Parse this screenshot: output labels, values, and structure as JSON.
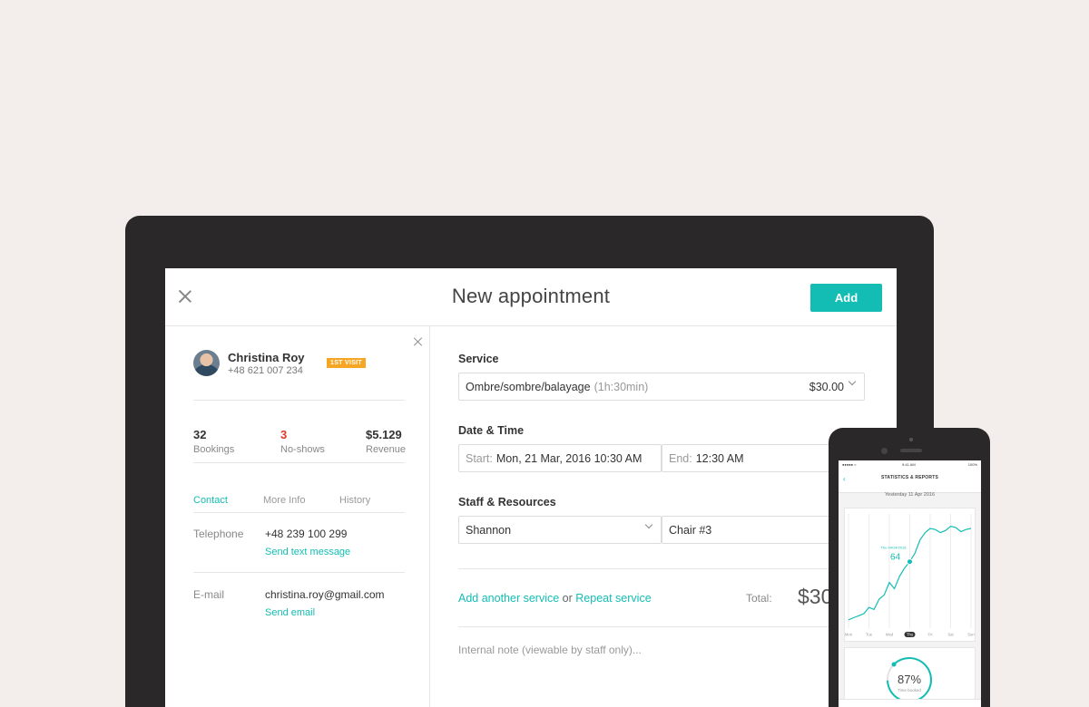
{
  "modal": {
    "title": "New appointment",
    "add_label": "Add"
  },
  "client": {
    "name": "Christina Roy",
    "phone": "+48 621 007 234",
    "badge": "1ST VISIT",
    "stats": [
      {
        "value": "32",
        "label": "Bookings"
      },
      {
        "value": "3",
        "label": "No-shows"
      },
      {
        "value": "$5.129",
        "label": "Revenue"
      }
    ],
    "tabs": [
      "Contact",
      "More Info",
      "History"
    ],
    "contact": {
      "telephone_label": "Telephone",
      "telephone_value": "+48 239 100 299",
      "telephone_link": "Send text message",
      "email_label": "E-mail",
      "email_value": "christina.roy@gmail.com",
      "email_link": "Send email"
    }
  },
  "form": {
    "service_label": "Service",
    "service_value": "Ombre/sombre/balayage",
    "service_duration": "(1h:30min)",
    "service_price": "$30.00",
    "datetime_label": "Date & Time",
    "start_prefix": "Start:",
    "start_value": "Mon, 21 Mar, 2016 10:30 AM",
    "end_prefix": "End:",
    "end_value": "12:30 AM",
    "staff_label": "Staff & Resources",
    "staff_value": "Shannon",
    "resource_value": "Chair #3",
    "add_service_link": "Add another service",
    "or_text": "or",
    "repeat_link": "Repeat service",
    "total_label": "Total:",
    "total_value": "$30",
    "note_placeholder": "Internal note (viewable by staff only)..."
  },
  "phone": {
    "status_carrier": "●●●●● ≈",
    "status_time": "9:41 AM",
    "status_battery": "100%",
    "nav_title": "STATISTICS & REPORTS",
    "date": "Yesterday 11 Apr 2016",
    "point_date": "Thu 04/14/2016",
    "point_value": "64",
    "days": [
      "Mon",
      "Tue",
      "Wed",
      "Thu",
      "Fri",
      "Sat",
      "Sun"
    ],
    "gauge_value": "87%",
    "gauge_label": "Time booked",
    "gauge_fraction": 0.87,
    "accent": "#13bdb4"
  },
  "chart_data": {
    "type": "line",
    "categories": [
      "Mon",
      "Tue",
      "Wed",
      "Thu",
      "Fri",
      "Sat",
      "Sun"
    ],
    "x": [
      0,
      0.25,
      0.5,
      0.75,
      1,
      1.25,
      1.5,
      1.75,
      2,
      2.25,
      2.5,
      2.75,
      3,
      3.25,
      3.5,
      3.75,
      4,
      4.25,
      4.5,
      4.75,
      5,
      5.25,
      5.5,
      5.75,
      6
    ],
    "series": [
      {
        "values": [
          8,
          10,
          12,
          14,
          20,
          18,
          28,
          32,
          44,
          38,
          50,
          58,
          64,
          72,
          85,
          92,
          96,
          95,
          92,
          94,
          98,
          97,
          93,
          95,
          96
        ]
      }
    ],
    "highlight": {
      "category": "Thu",
      "value": 64
    },
    "ylim": [
      0,
      110
    ]
  }
}
